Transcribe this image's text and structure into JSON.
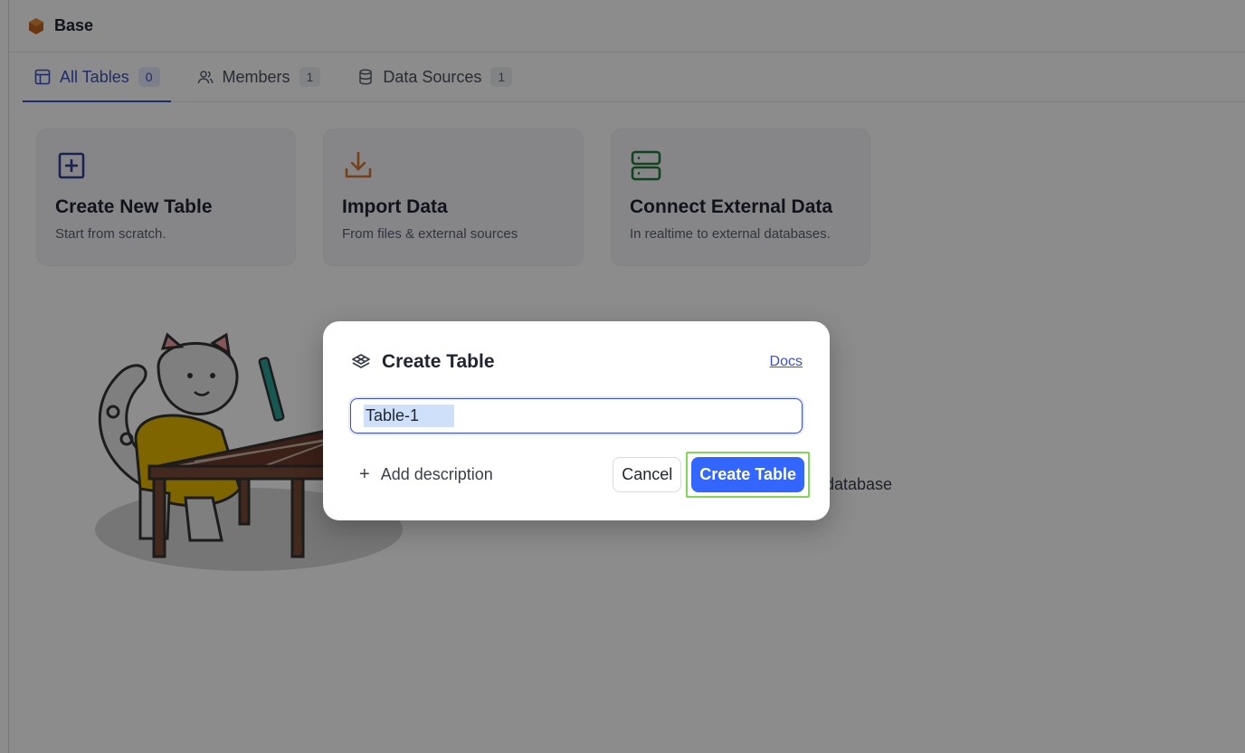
{
  "header": {
    "title": "Base"
  },
  "tabs": [
    {
      "label": "All Tables",
      "count": "0",
      "icon": "table-icon",
      "active": true
    },
    {
      "label": "Members",
      "count": "1",
      "icon": "users-icon",
      "active": false
    },
    {
      "label": "Data Sources",
      "count": "1",
      "icon": "database-icon",
      "active": false
    }
  ],
  "cards": [
    {
      "title": "Create New Table",
      "subtitle": "Start from scratch.",
      "icon": "plus-square-icon",
      "color": "#2f3f96"
    },
    {
      "title": "Import Data",
      "subtitle": "From files & external sources",
      "icon": "download-icon",
      "color": "#d9772b"
    },
    {
      "title": "Connect External Data",
      "subtitle": "In realtime to external databases.",
      "icon": "server-icon",
      "color": "#1f7a3a"
    }
  ],
  "background": {
    "partial_text": "database"
  },
  "modal": {
    "title": "Create Table",
    "docs_label": "Docs",
    "input_value": "Table-1",
    "add_description_label": "Add description",
    "cancel_label": "Cancel",
    "create_label": "Create Table"
  },
  "colors": {
    "accent": "#3b4fc4",
    "primary_button": "#3266ff",
    "highlight_outline": "#7ed957",
    "base_icon": "#c2611f"
  }
}
